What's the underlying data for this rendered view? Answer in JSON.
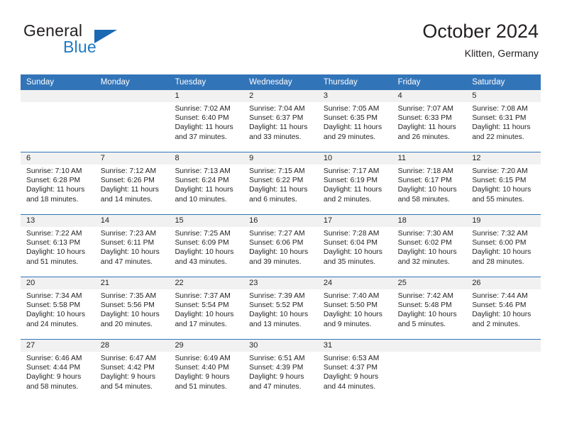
{
  "brand": {
    "name_top": "General",
    "name_bottom": "Blue",
    "triangle_color": "#1b69b3",
    "blue_color": "#1f7ac4"
  },
  "header": {
    "title": "October 2024",
    "subtitle": "Klitten, Germany"
  },
  "theme": {
    "header_blue": "#3274b8",
    "date_band_gray": "#f1f1f1",
    "text": "#231f20"
  },
  "weekday_headers": [
    "Sunday",
    "Monday",
    "Tuesday",
    "Wednesday",
    "Thursday",
    "Friday",
    "Saturday"
  ],
  "weeks": [
    [
      {
        "day": "",
        "lines": []
      },
      {
        "day": "",
        "lines": []
      },
      {
        "day": "1",
        "lines": [
          "Sunrise: 7:02 AM",
          "Sunset: 6:40 PM",
          "Daylight: 11 hours",
          "and 37 minutes."
        ]
      },
      {
        "day": "2",
        "lines": [
          "Sunrise: 7:04 AM",
          "Sunset: 6:37 PM",
          "Daylight: 11 hours",
          "and 33 minutes."
        ]
      },
      {
        "day": "3",
        "lines": [
          "Sunrise: 7:05 AM",
          "Sunset: 6:35 PM",
          "Daylight: 11 hours",
          "and 29 minutes."
        ]
      },
      {
        "day": "4",
        "lines": [
          "Sunrise: 7:07 AM",
          "Sunset: 6:33 PM",
          "Daylight: 11 hours",
          "and 26 minutes."
        ]
      },
      {
        "day": "5",
        "lines": [
          "Sunrise: 7:08 AM",
          "Sunset: 6:31 PM",
          "Daylight: 11 hours",
          "and 22 minutes."
        ]
      }
    ],
    [
      {
        "day": "6",
        "lines": [
          "Sunrise: 7:10 AM",
          "Sunset: 6:28 PM",
          "Daylight: 11 hours",
          "and 18 minutes."
        ]
      },
      {
        "day": "7",
        "lines": [
          "Sunrise: 7:12 AM",
          "Sunset: 6:26 PM",
          "Daylight: 11 hours",
          "and 14 minutes."
        ]
      },
      {
        "day": "8",
        "lines": [
          "Sunrise: 7:13 AM",
          "Sunset: 6:24 PM",
          "Daylight: 11 hours",
          "and 10 minutes."
        ]
      },
      {
        "day": "9",
        "lines": [
          "Sunrise: 7:15 AM",
          "Sunset: 6:22 PM",
          "Daylight: 11 hours",
          "and 6 minutes."
        ]
      },
      {
        "day": "10",
        "lines": [
          "Sunrise: 7:17 AM",
          "Sunset: 6:19 PM",
          "Daylight: 11 hours",
          "and 2 minutes."
        ]
      },
      {
        "day": "11",
        "lines": [
          "Sunrise: 7:18 AM",
          "Sunset: 6:17 PM",
          "Daylight: 10 hours",
          "and 58 minutes."
        ]
      },
      {
        "day": "12",
        "lines": [
          "Sunrise: 7:20 AM",
          "Sunset: 6:15 PM",
          "Daylight: 10 hours",
          "and 55 minutes."
        ]
      }
    ],
    [
      {
        "day": "13",
        "lines": [
          "Sunrise: 7:22 AM",
          "Sunset: 6:13 PM",
          "Daylight: 10 hours",
          "and 51 minutes."
        ]
      },
      {
        "day": "14",
        "lines": [
          "Sunrise: 7:23 AM",
          "Sunset: 6:11 PM",
          "Daylight: 10 hours",
          "and 47 minutes."
        ]
      },
      {
        "day": "15",
        "lines": [
          "Sunrise: 7:25 AM",
          "Sunset: 6:09 PM",
          "Daylight: 10 hours",
          "and 43 minutes."
        ]
      },
      {
        "day": "16",
        "lines": [
          "Sunrise: 7:27 AM",
          "Sunset: 6:06 PM",
          "Daylight: 10 hours",
          "and 39 minutes."
        ]
      },
      {
        "day": "17",
        "lines": [
          "Sunrise: 7:28 AM",
          "Sunset: 6:04 PM",
          "Daylight: 10 hours",
          "and 35 minutes."
        ]
      },
      {
        "day": "18",
        "lines": [
          "Sunrise: 7:30 AM",
          "Sunset: 6:02 PM",
          "Daylight: 10 hours",
          "and 32 minutes."
        ]
      },
      {
        "day": "19",
        "lines": [
          "Sunrise: 7:32 AM",
          "Sunset: 6:00 PM",
          "Daylight: 10 hours",
          "and 28 minutes."
        ]
      }
    ],
    [
      {
        "day": "20",
        "lines": [
          "Sunrise: 7:34 AM",
          "Sunset: 5:58 PM",
          "Daylight: 10 hours",
          "and 24 minutes."
        ]
      },
      {
        "day": "21",
        "lines": [
          "Sunrise: 7:35 AM",
          "Sunset: 5:56 PM",
          "Daylight: 10 hours",
          "and 20 minutes."
        ]
      },
      {
        "day": "22",
        "lines": [
          "Sunrise: 7:37 AM",
          "Sunset: 5:54 PM",
          "Daylight: 10 hours",
          "and 17 minutes."
        ]
      },
      {
        "day": "23",
        "lines": [
          "Sunrise: 7:39 AM",
          "Sunset: 5:52 PM",
          "Daylight: 10 hours",
          "and 13 minutes."
        ]
      },
      {
        "day": "24",
        "lines": [
          "Sunrise: 7:40 AM",
          "Sunset: 5:50 PM",
          "Daylight: 10 hours",
          "and 9 minutes."
        ]
      },
      {
        "day": "25",
        "lines": [
          "Sunrise: 7:42 AM",
          "Sunset: 5:48 PM",
          "Daylight: 10 hours",
          "and 5 minutes."
        ]
      },
      {
        "day": "26",
        "lines": [
          "Sunrise: 7:44 AM",
          "Sunset: 5:46 PM",
          "Daylight: 10 hours",
          "and 2 minutes."
        ]
      }
    ],
    [
      {
        "day": "27",
        "lines": [
          "Sunrise: 6:46 AM",
          "Sunset: 4:44 PM",
          "Daylight: 9 hours",
          "and 58 minutes."
        ]
      },
      {
        "day": "28",
        "lines": [
          "Sunrise: 6:47 AM",
          "Sunset: 4:42 PM",
          "Daylight: 9 hours",
          "and 54 minutes."
        ]
      },
      {
        "day": "29",
        "lines": [
          "Sunrise: 6:49 AM",
          "Sunset: 4:40 PM",
          "Daylight: 9 hours",
          "and 51 minutes."
        ]
      },
      {
        "day": "30",
        "lines": [
          "Sunrise: 6:51 AM",
          "Sunset: 4:39 PM",
          "Daylight: 9 hours",
          "and 47 minutes."
        ]
      },
      {
        "day": "31",
        "lines": [
          "Sunrise: 6:53 AM",
          "Sunset: 4:37 PM",
          "Daylight: 9 hours",
          "and 44 minutes."
        ]
      },
      {
        "day": "",
        "lines": []
      },
      {
        "day": "",
        "lines": []
      }
    ]
  ]
}
